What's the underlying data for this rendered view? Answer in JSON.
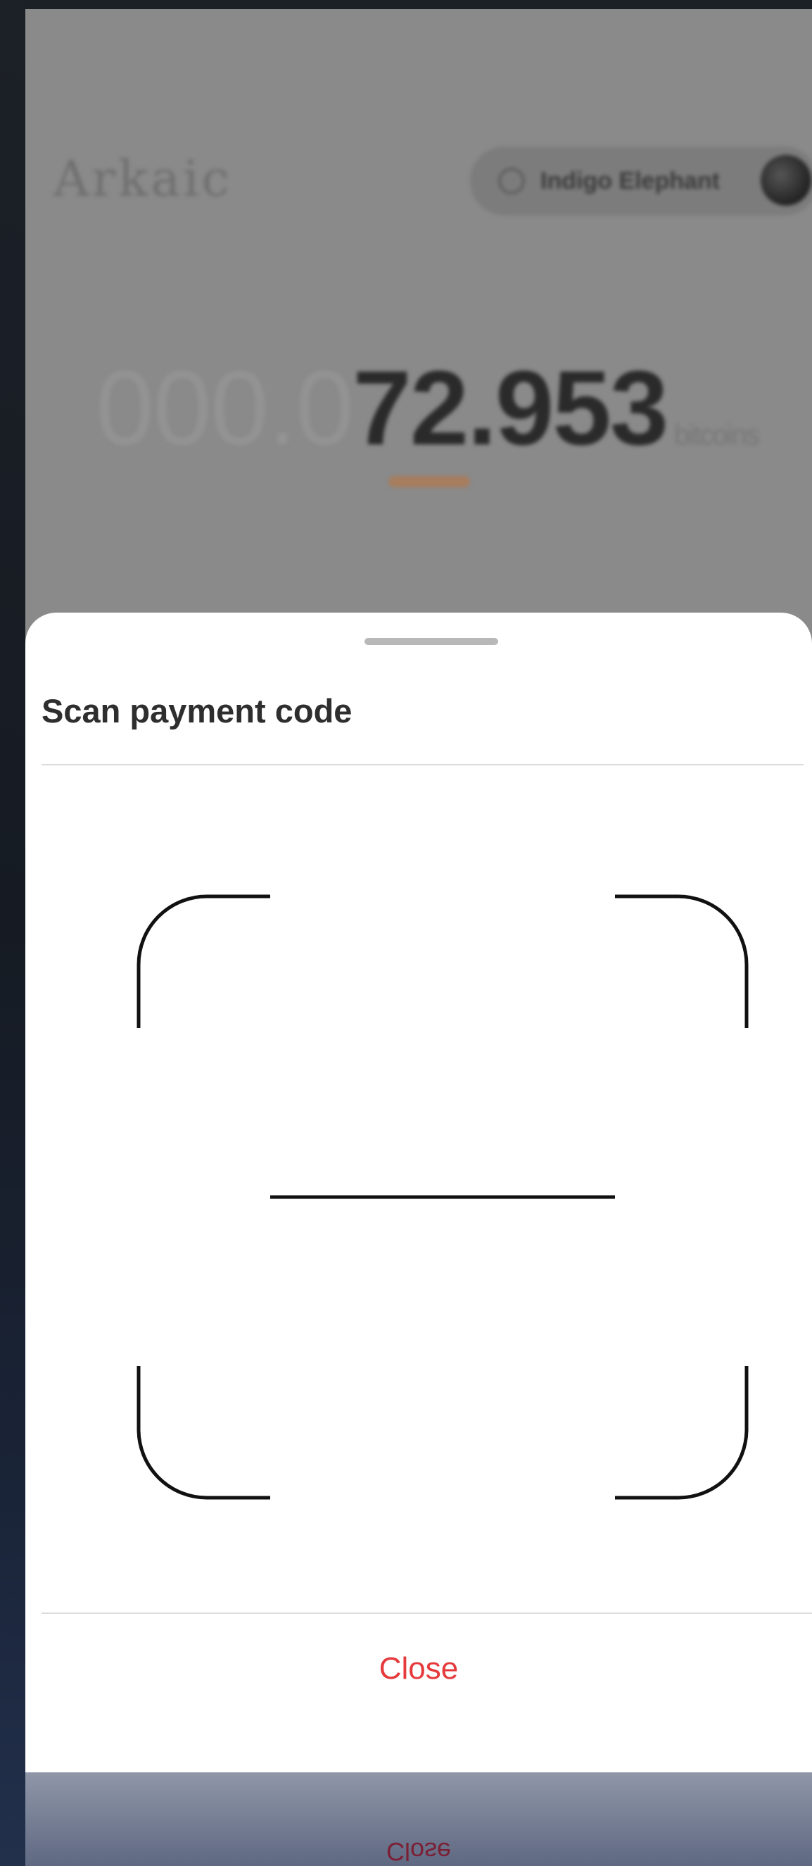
{
  "background": {
    "logo": "Arkaic",
    "user_name": "Indigo Elephant",
    "balance_dim": "000.0",
    "balance_strong": "72.953",
    "balance_unit": "bitcoins",
    "mirrored_close": "Close"
  },
  "sheet": {
    "title": "Scan payment code",
    "close_label": "Close"
  },
  "colors": {
    "close": "#e5393b",
    "accent_underline": "#b3774a"
  },
  "icons": {
    "scanner": "qr-scan-frame-icon",
    "search": "search-icon",
    "avatar": "avatar"
  }
}
